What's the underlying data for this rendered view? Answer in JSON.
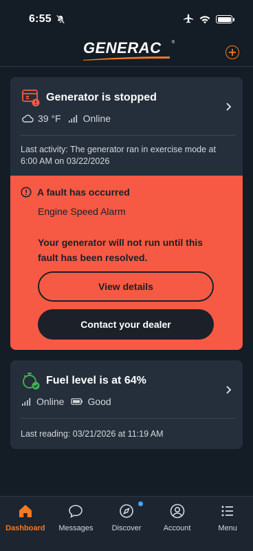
{
  "status_bar": {
    "time": "6:55"
  },
  "header": {
    "logo": "GENERAC",
    "logo_reg": "®"
  },
  "generator": {
    "title": "Generator is stopped",
    "temperature": "39 °F",
    "connection": "Online",
    "last_activity": "Last activity: The generator ran in exercise mode at 6:00 AM on 03/22/2026",
    "fault": {
      "title": "A fault has occurred",
      "name": "Engine Speed Alarm",
      "warning": "Your generator will not run until this fault has been resolved.",
      "view_details_label": "View details",
      "contact_dealer_label": "Contact your dealer"
    }
  },
  "fuel": {
    "title": "Fuel level is at 64%",
    "connection": "Online",
    "battery": "Good",
    "last_reading": "Last reading: 03/21/2026 at 11:19 AM"
  },
  "nav": {
    "items": [
      {
        "label": "Dashboard",
        "icon": "home-icon"
      },
      {
        "label": "Messages",
        "icon": "chat-bubble-icon"
      },
      {
        "label": "Discover",
        "icon": "compass-icon"
      },
      {
        "label": "Account",
        "icon": "account-icon"
      },
      {
        "label": "Menu",
        "icon": "menu-list-icon"
      }
    ]
  },
  "colors": {
    "accent": "#f47a20",
    "fault": "#f65a44",
    "card": "#252f3b",
    "background": "#141c26",
    "success": "#3fb34f",
    "notification": "#4aa3ff"
  }
}
